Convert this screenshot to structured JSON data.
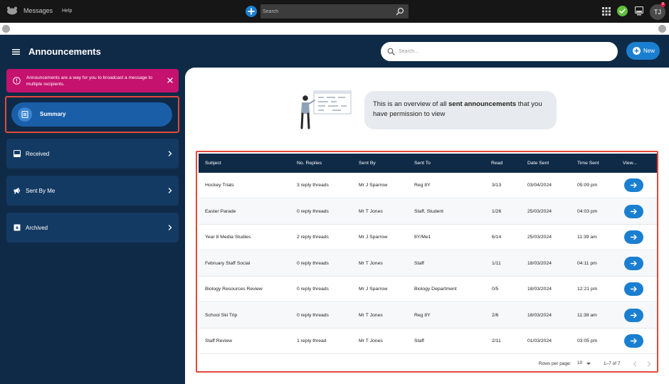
{
  "topbar": {
    "app_title": "Messages",
    "help": "Help",
    "search_placeholder": "Search",
    "avatar_initials": "TJ",
    "notification_count": "8"
  },
  "header": {
    "title": "Announcements",
    "search_placeholder": "Search...",
    "new_label": "New"
  },
  "sidebar": {
    "alert_text": "Announcements are a way for you to broadcast a message to multiple recipients.",
    "summary_label": "Summary",
    "received_label": "Received",
    "sent_by_me_label": "Sent By Me",
    "archived_label": "Archived"
  },
  "overview": {
    "text_before": "This is an overview of all ",
    "text_bold": "sent announcements",
    "text_after": " that you have permission to view"
  },
  "table": {
    "headers": [
      "Subject",
      "No. Replies",
      "Sent By",
      "Sent To",
      "Read",
      "Date Sent",
      "Time Sent",
      "View..."
    ],
    "rows": [
      {
        "subject": "Hockey Trials",
        "replies": "3 reply threads",
        "sent_by": "Mr J Sparrow",
        "sent_to": "Reg 8Y",
        "read": "3/13",
        "date": "03/04/2024",
        "time": "05:09 pm"
      },
      {
        "subject": "Easter Parade",
        "replies": "0 reply threads",
        "sent_by": "Mr T Jones",
        "sent_to": "Staff, Student",
        "read": "1/26",
        "date": "25/03/2024",
        "time": "04:03 pm"
      },
      {
        "subject": "Year 8 Media Studies",
        "replies": "2 reply threads",
        "sent_by": "Mr J Sparrow",
        "sent_to": "8Y/Me1",
        "read": "6/14",
        "date": "25/03/2024",
        "time": "11:39 am"
      },
      {
        "subject": "February Staff Social",
        "replies": "0 reply threads",
        "sent_by": "Mr T Jones",
        "sent_to": "Staff",
        "read": "1/11",
        "date": "18/03/2024",
        "time": "04:11 pm"
      },
      {
        "subject": "Biology Resources Review",
        "replies": "0 reply threads",
        "sent_by": "Mr J Sparrow",
        "sent_to": "Biology Department",
        "read": "0/5",
        "date": "18/03/2024",
        "time": "12:21 pm"
      },
      {
        "subject": "School Ski Trip",
        "replies": "0 reply threads",
        "sent_by": "Mr T Jones",
        "sent_to": "Reg 8Y",
        "read": "2/6",
        "date": "18/03/2024",
        "time": "11:38 am"
      },
      {
        "subject": "Staff Review",
        "replies": "1 reply thread",
        "sent_by": "Mr T Jones",
        "sent_to": "Staff",
        "read": "2/11",
        "date": "01/03/2024",
        "time": "03:05 pm"
      }
    ],
    "rows_per_page_label": "Rows per page:",
    "rows_per_page": "10",
    "range": "1–7 of 7"
  },
  "colors": {
    "navy": "#0f2a47",
    "accent_blue": "#1a7fd0",
    "alert_magenta": "#c4126e",
    "highlight_red": "#e2483b"
  },
  "icons": [
    "logo-icon",
    "plus-icon",
    "search-icon",
    "apps-grid-icon",
    "check-icon",
    "monitor-icon",
    "menu-icon",
    "info-icon",
    "close-icon",
    "summary-icon",
    "inbox-icon",
    "megaphone-icon",
    "archive-icon",
    "chevron-right-icon",
    "arrow-right-icon"
  ]
}
